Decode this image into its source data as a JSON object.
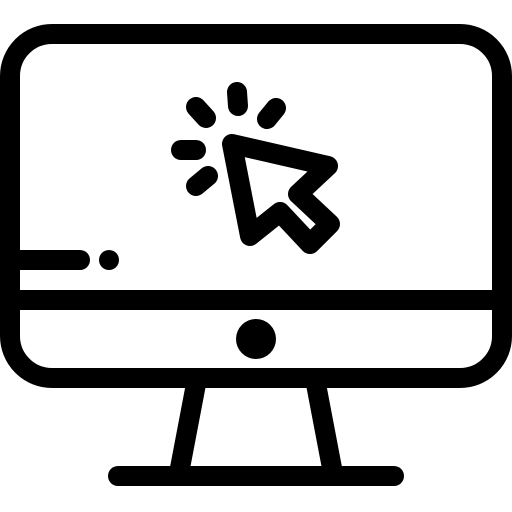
{
  "icon": {
    "name": "desktop-computer-click-icon",
    "parts": [
      "monitor-icon",
      "cursor-icon",
      "click-burst-icon",
      "power-button-icon",
      "stand-icon"
    ]
  },
  "colors": {
    "stroke": "#000000",
    "background": "#ffffff"
  }
}
